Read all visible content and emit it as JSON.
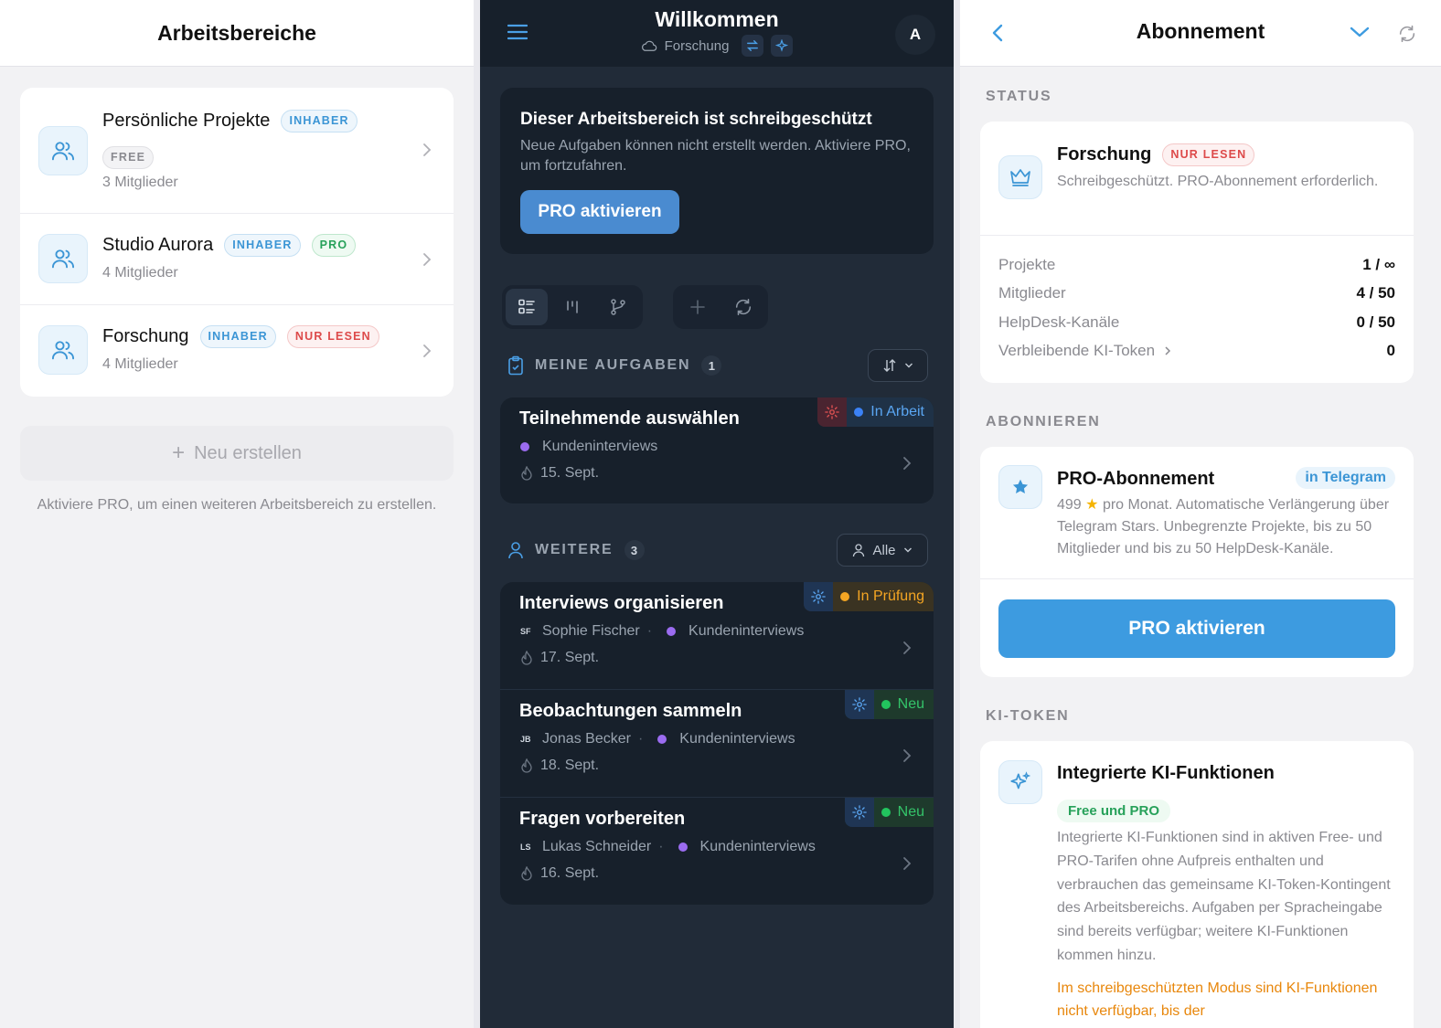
{
  "left": {
    "title": "Arbeitsbereiche",
    "workspaces": [
      {
        "name": "Persönliche Projekte",
        "role": "INHABER",
        "plan": "FREE",
        "members": "3 Mitglieder"
      },
      {
        "name": "Studio Aurora",
        "role": "INHABER",
        "plan": "PRO",
        "members": "4 Mitglieder"
      },
      {
        "name": "Forschung",
        "role": "INHABER",
        "plan": "NUR LESEN",
        "members": "4 Mitglieder"
      }
    ],
    "new_button": "Neu erstellen",
    "note": "Aktiviere PRO, um einen weiteren Arbeitsbereich zu erstellen."
  },
  "middle": {
    "title": "Willkommen",
    "workspace": "Forschung",
    "avatar": "A",
    "readonly": {
      "title": "Dieser Arbeitsbereich ist schreibgeschützt",
      "text": "Neue Aufgaben können nicht erstellt werden. Aktiviere PRO, um fortzufahren.",
      "button": "PRO aktivieren"
    },
    "my_tasks": {
      "label": "MEINE AUFGABEN",
      "count": "1"
    },
    "other_tasks": {
      "label": "WEITERE",
      "count": "3",
      "filter": "Alle"
    },
    "tasks_mine": [
      {
        "title": "Teilnehmende auswählen",
        "project": "Kundeninterviews",
        "date": "15. Sept.",
        "status": "In Arbeit"
      }
    ],
    "tasks_other": [
      {
        "title": "Interviews organisieren",
        "initials": "SF",
        "assignee": "Sophie Fischer",
        "project": "Kundeninterviews",
        "date": "17. Sept.",
        "status": "In Prüfung"
      },
      {
        "title": "Beobachtungen sammeln",
        "initials": "JB",
        "assignee": "Jonas Becker",
        "project": "Kundeninterviews",
        "date": "18. Sept.",
        "status": "Neu"
      },
      {
        "title": "Fragen vorbereiten",
        "initials": "LS",
        "assignee": "Lukas Schneider",
        "project": "Kundeninterviews",
        "date": "16. Sept.",
        "status": "Neu"
      }
    ]
  },
  "right": {
    "title": "Abonnement",
    "status_section": "STATUS",
    "status_card": {
      "name": "Forschung",
      "badge": "NUR LESEN",
      "text": "Schreibgeschützt. PRO-Abonnement erforderlich.",
      "stats": [
        {
          "label": "Projekte",
          "value": "1 / ∞"
        },
        {
          "label": "Mitglieder",
          "value": "4 / 50"
        },
        {
          "label": "HelpDesk-Kanäle",
          "value": "0 / 50"
        },
        {
          "label": "Verbleibende KI-Token",
          "value": "0"
        }
      ]
    },
    "subscribe_section": "ABONNIEREN",
    "subscribe_card": {
      "title": "PRO-Abonnement",
      "badge": "in Telegram",
      "price": "499",
      "text": "pro Monat. Automatische Verlängerung über Telegram Stars. Unbegrenzte Projekte, bis zu 50 Mitglieder und bis zu 50 HelpDesk-Kanäle.",
      "button": "PRO aktivieren"
    },
    "ai_section": "KI-TOKEN",
    "ai_card": {
      "title": "Integrierte KI-Funktionen",
      "badge": "Free und PRO",
      "text": "Integrierte KI-Funktionen sind in aktiven Free- und PRO-Tarifen ohne Aufpreis enthalten und verbrauchen das gemeinsame KI-Token-Kontingent des Arbeitsbereichs. Aufgaben per Spracheingabe sind bereits verfügbar; weitere KI-Funktionen kommen hinzu.",
      "warning": "Im schreibgeschützten Modus sind KI-Funktionen nicht verfügbar, bis der"
    }
  },
  "colors": {
    "accent": "#3d9be0",
    "dark_bg": "#212b38",
    "status_in_progress": "#3b82f6",
    "status_review": "#f5a623",
    "status_new": "#22c55e",
    "readonly_red": "#dd4a4a",
    "pro_green": "#27a15a"
  }
}
